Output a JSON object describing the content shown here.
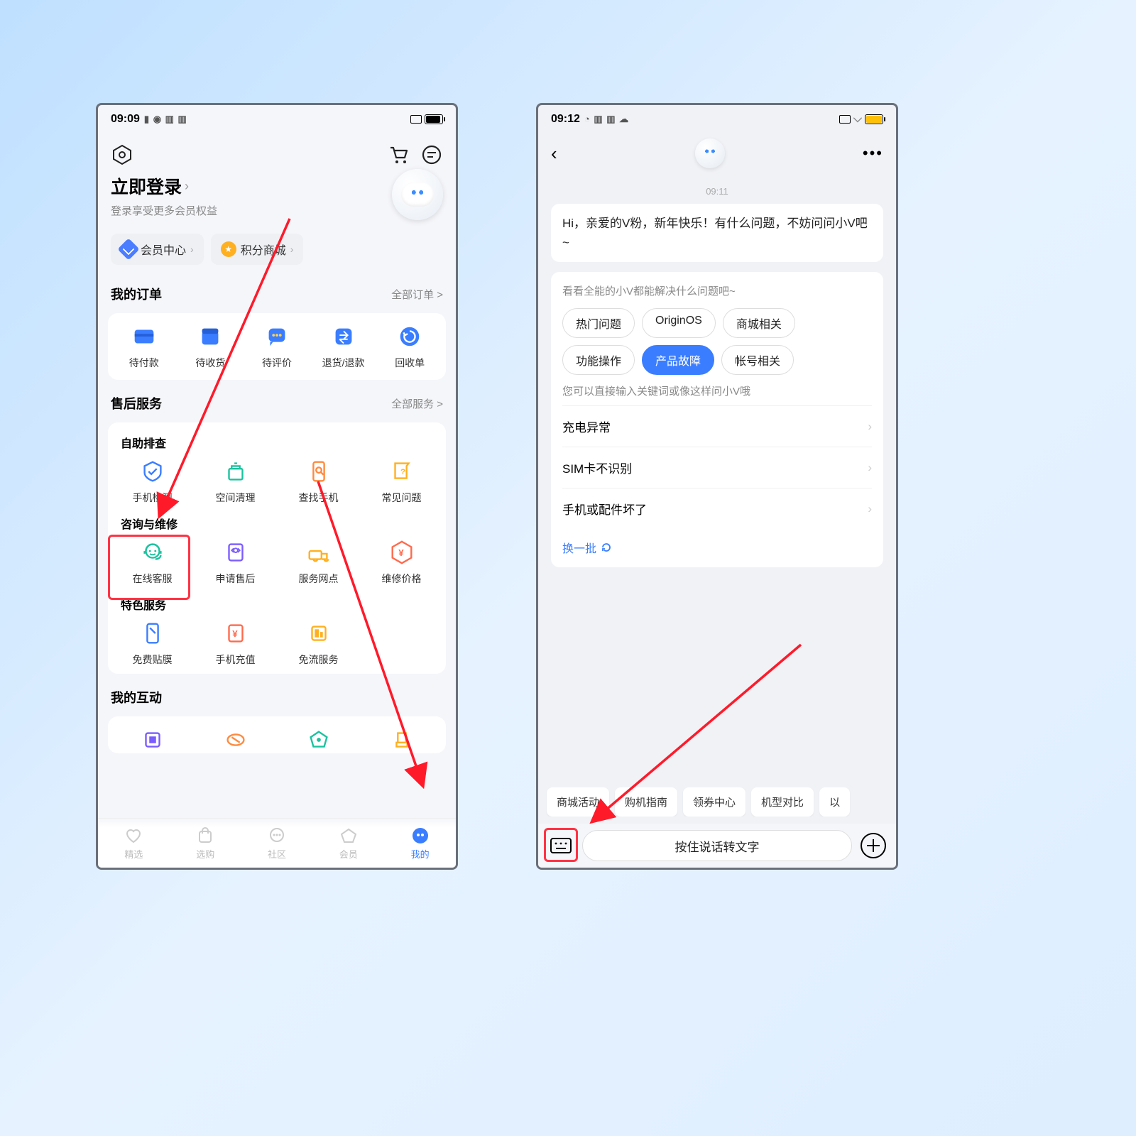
{
  "left": {
    "status": {
      "time": "09:09"
    },
    "login": {
      "title": "立即登录",
      "sub": "登录享受更多会员权益"
    },
    "chips": {
      "member": "会员中心",
      "points": "积分商城"
    },
    "orders": {
      "title": "我的订单",
      "link": "全部订单 >",
      "items": [
        "待付款",
        "待收货",
        "待评价",
        "退货/退款",
        "回收单"
      ]
    },
    "service": {
      "title": "售后服务",
      "link": "全部服务 >",
      "selfcheck": {
        "title": "自助排查",
        "items": [
          "手机检测",
          "空间清理",
          "查找手机",
          "常见问题"
        ]
      },
      "consult": {
        "title": "咨询与维修",
        "items": [
          "在线客服",
          "申请售后",
          "服务网点",
          "维修价格"
        ]
      },
      "special": {
        "title": "特色服务",
        "items": [
          "免费贴膜",
          "手机充值",
          "免流服务"
        ]
      }
    },
    "interact": {
      "title": "我的互动"
    },
    "tabs": [
      "精选",
      "选购",
      "社区",
      "会员",
      "我的"
    ]
  },
  "right": {
    "status": {
      "time": "09:12"
    },
    "chat": {
      "time": "09:11",
      "greeting": "Hi，亲爱的V粉，新年快乐！有什么问题，不妨问问小V吧~",
      "hint1": "看看全能的小V都能解决什么问题吧~",
      "tags": [
        "热门问题",
        "OriginOS",
        "商城相关",
        "功能操作",
        "产品故障",
        "帐号相关"
      ],
      "activeTag": "产品故障",
      "hint2": "您可以直接输入关键词或像这样问小V哦",
      "list": [
        "充电异常",
        "SIM卡不识别",
        "手机或配件坏了"
      ],
      "refresh": "换一批"
    },
    "quick": [
      "商城活动",
      "购机指南",
      "领券中心",
      "机型对比",
      "以"
    ],
    "input": {
      "placeholder": "按住说话转文字"
    }
  }
}
